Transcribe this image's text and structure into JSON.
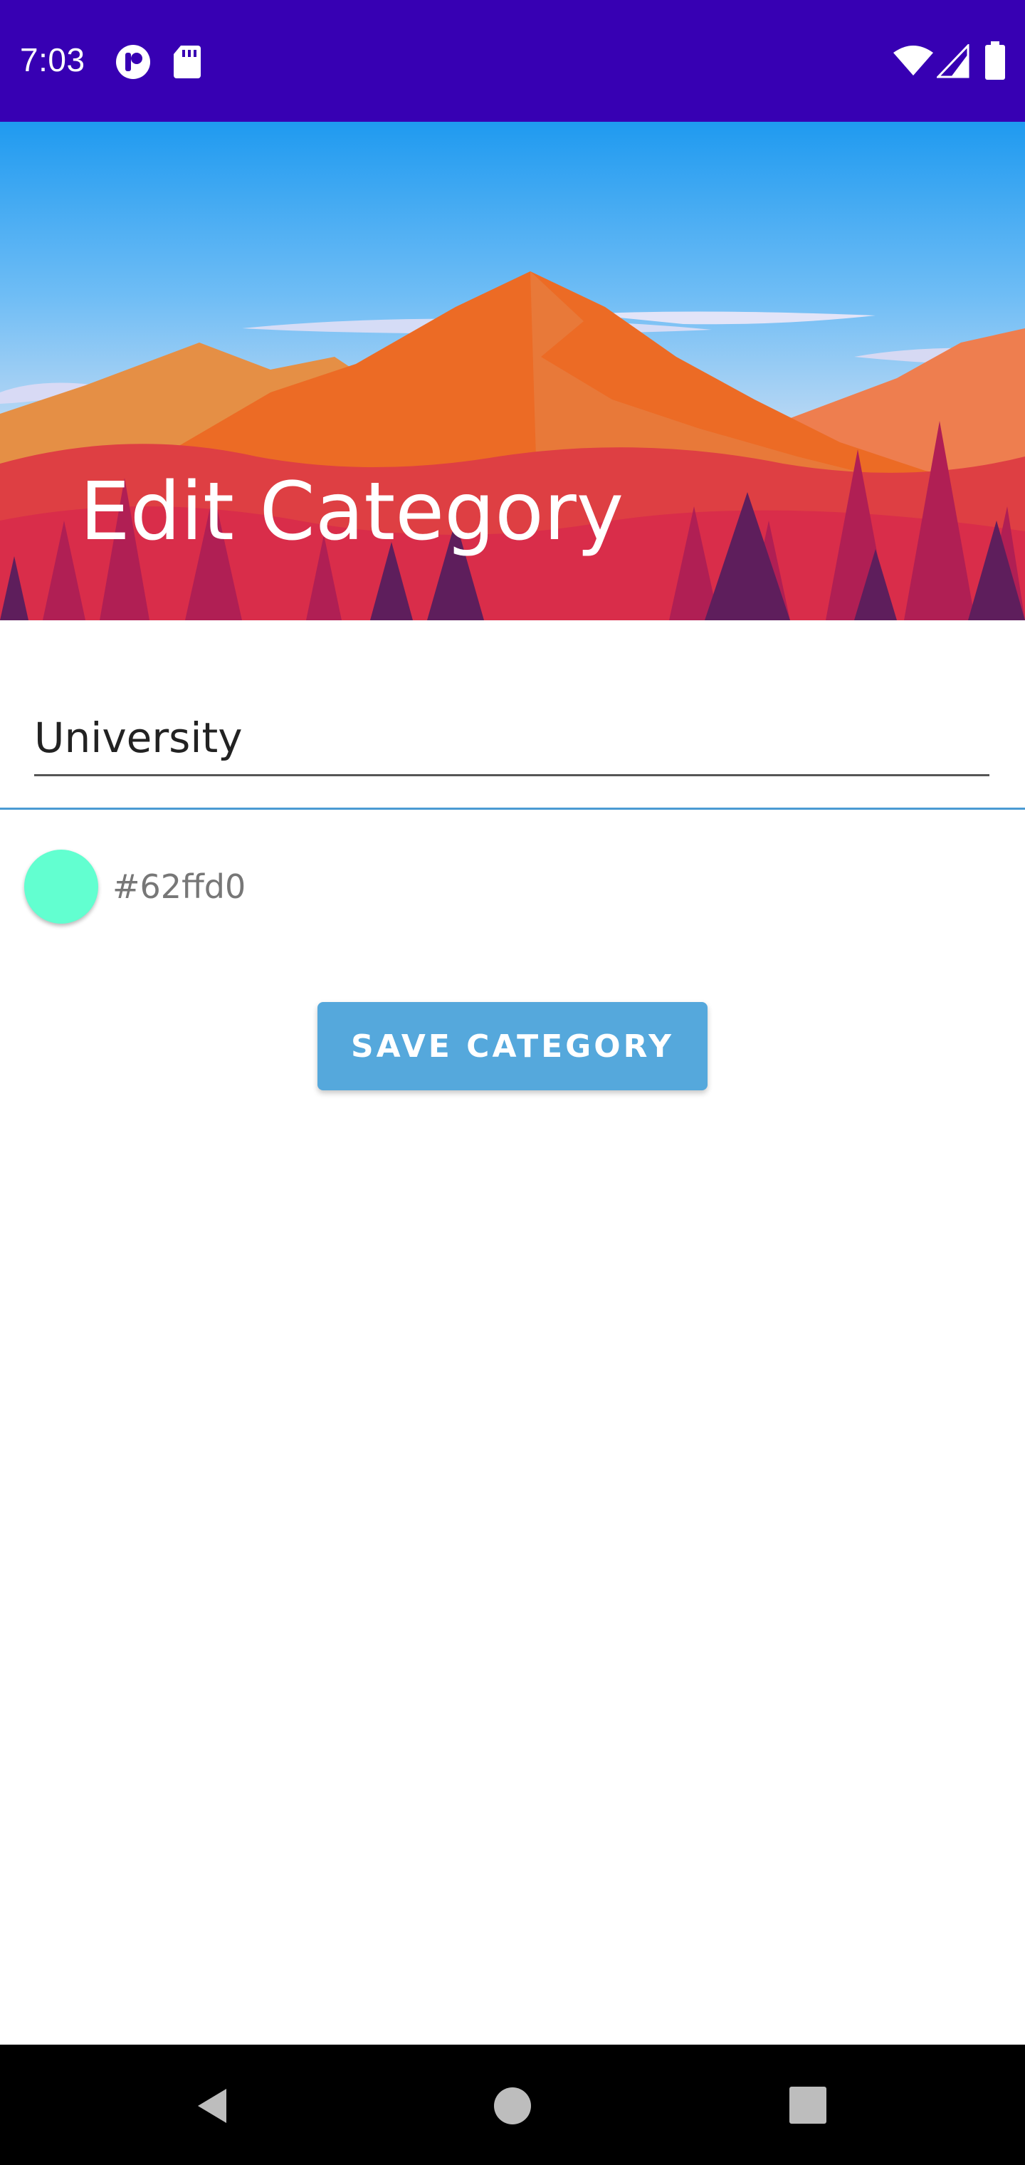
{
  "status_bar": {
    "time": "7:03",
    "background": "#3700b3",
    "left_icons": [
      "account-circle-icon",
      "sd-card-icon"
    ],
    "right_icons": [
      "wifi-icon",
      "cell-signal-icon",
      "battery-icon"
    ]
  },
  "header": {
    "title": "Edit Category",
    "background_image": "mountain-landscape-illustration"
  },
  "form": {
    "name_value": "University",
    "divider_color": "#4a9bd3"
  },
  "color": {
    "hex_label": "#62ffd0",
    "swatch_color": "#62ffd0"
  },
  "actions": {
    "save_label": "SAVE CATEGORY",
    "save_color": "#55a8dc"
  },
  "nav_bar": {
    "buttons": [
      "back-icon",
      "home-icon",
      "recents-icon"
    ]
  }
}
